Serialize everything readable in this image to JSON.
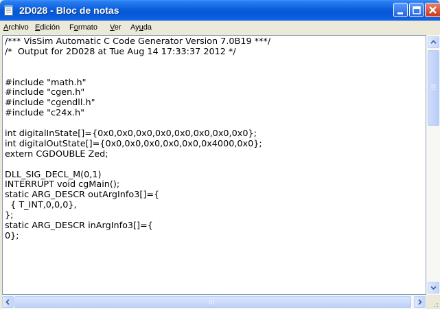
{
  "window": {
    "title": "2D028 - Bloc de notas",
    "icon": "notepad-icon"
  },
  "caption_buttons": [
    "minimize-icon",
    "maximize-icon",
    "close-icon"
  ],
  "menu": {
    "items": [
      "Archivo",
      "Edición",
      "Formato",
      "Ver",
      "Ayuda"
    ],
    "mnemonics": [
      "A",
      "E",
      "o",
      "V",
      "u"
    ]
  },
  "editor": {
    "lines": [
      "/*** VisSim Automatic C Code Generator Version 7.0B19 ***/",
      "/*  Output for 2D028 at Tue Aug 14 17:33:37 2012 */",
      "",
      "",
      "#include \"math.h\"",
      "#include \"cgen.h\"",
      "#include \"cgendll.h\"",
      "#include \"c24x.h\"",
      "",
      "int digitalInState[]={0x0,0x0,0x0,0x0,0x0,0x0,0x0,0x0};",
      "int digitalOutState[]={0x0,0x0,0x0,0x0,0x0,0x4000,0x0};",
      "extern CGDOUBLE Zed;",
      "",
      "DLL_SIG_DECL_M(0,1)",
      "INTERRUPT void cgMain();",
      "static ARG_DESCR outArgInfo3[]={",
      "  { T_INT,0,0,0},",
      "};",
      "static ARG_DESCR inArgInfo3[]={",
      "0};"
    ]
  },
  "colors": {
    "titlebar": "#0a5fdc",
    "chrome": "#ece9d8",
    "close_button": "#c93a18"
  }
}
